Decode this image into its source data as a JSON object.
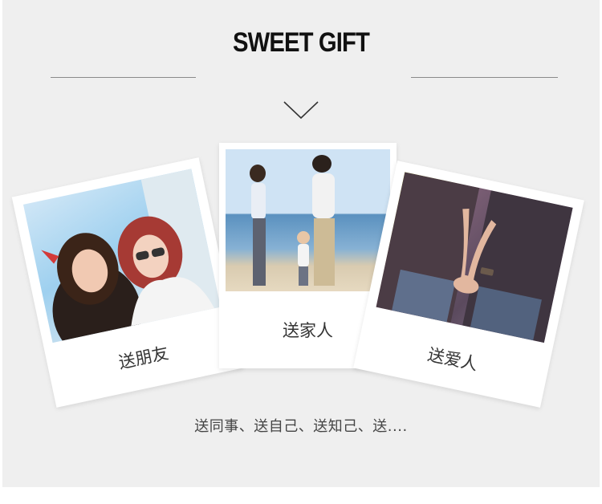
{
  "header": {
    "title": "SWEET GIFT"
  },
  "cards": {
    "friend": {
      "caption": "送朋友"
    },
    "family": {
      "caption": "送家人"
    },
    "lover": {
      "caption": "送爱人"
    }
  },
  "footer": {
    "text": "送同事、送自己、送知己、送...."
  }
}
